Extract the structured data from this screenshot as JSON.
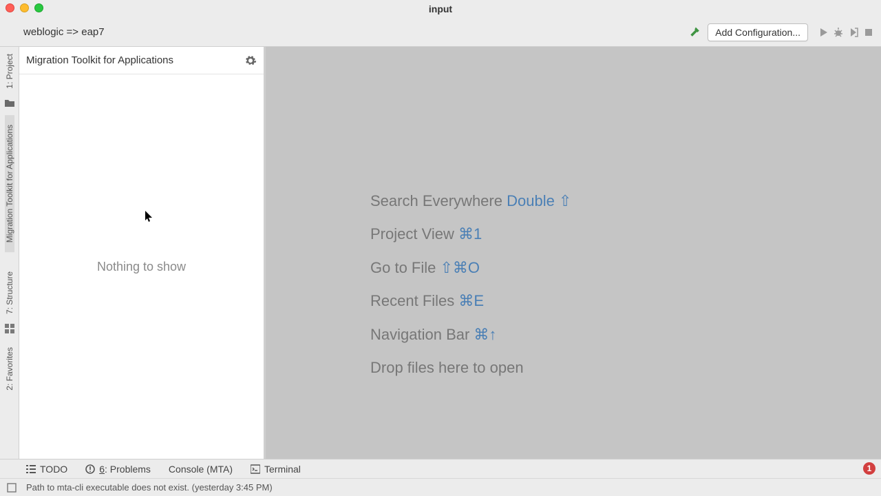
{
  "titlebar": {
    "title": "input"
  },
  "nav": {
    "breadcrumb": "weblogic => eap7",
    "add_configuration": "Add Configuration..."
  },
  "left_tabs": {
    "project": "1: Project",
    "mta": "Migration Toolkit for Applications",
    "structure": "7: Structure",
    "favorites": "2: Favorites"
  },
  "toolwin": {
    "title": "Migration Toolkit for Applications",
    "empty": "Nothing to show"
  },
  "tips": {
    "search_label": "Search Everywhere ",
    "search_sc": "Double ⇧",
    "project_label": "Project View ",
    "project_sc": "⌘1",
    "gotofile_label": "Go to File ",
    "gotofile_sc": "⇧⌘O",
    "recent_label": "Recent Files ",
    "recent_sc": "⌘E",
    "navbar_label": "Navigation Bar ",
    "navbar_sc": "⌘↑",
    "drop": "Drop files here to open"
  },
  "bottom": {
    "todo": "TODO",
    "problems_prefix": "6",
    "problems_rest": ": Problems",
    "console": "Console (MTA)",
    "terminal": "Terminal",
    "badge": "1"
  },
  "status": {
    "message": "Path to mta-cli executable does not exist. (yesterday 3:45 PM)"
  },
  "icons": {
    "hammer": "hammer-icon",
    "run": "run-icon",
    "debug": "debug-icon",
    "coverage": "coverage-icon",
    "stop": "stop-icon",
    "gear": "gear-icon",
    "folder": "folder-icon",
    "list": "list-icon",
    "warning": "warning-icon",
    "terminal": "terminal-icon",
    "box": "box-icon"
  }
}
